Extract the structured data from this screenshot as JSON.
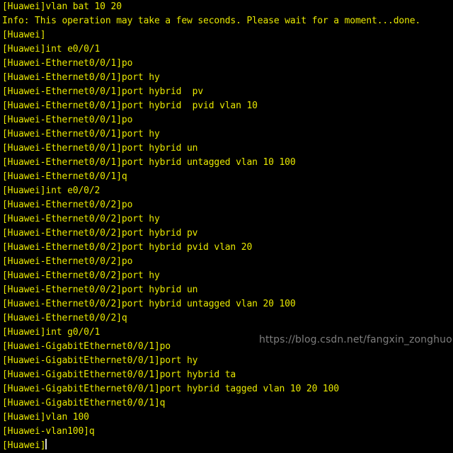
{
  "terminal": {
    "background_color": "#000000",
    "text_color": "#e8e800",
    "cursor_color": "#d9d9d9",
    "lines": [
      "[Huawei]vlan bat 10 20",
      "Info: This operation may take a few seconds. Please wait for a moment...done.",
      "[Huawei]",
      "[Huawei]int e0/0/1",
      "[Huawei-Ethernet0/0/1]po",
      "[Huawei-Ethernet0/0/1]port hy",
      "[Huawei-Ethernet0/0/1]port hybrid  pv",
      "[Huawei-Ethernet0/0/1]port hybrid  pvid vlan 10",
      "[Huawei-Ethernet0/0/1]po",
      "[Huawei-Ethernet0/0/1]port hy",
      "[Huawei-Ethernet0/0/1]port hybrid un",
      "[Huawei-Ethernet0/0/1]port hybrid untagged vlan 10 100",
      "[Huawei-Ethernet0/0/1]q",
      "[Huawei]int e0/0/2",
      "[Huawei-Ethernet0/0/2]po",
      "[Huawei-Ethernet0/0/2]port hy",
      "[Huawei-Ethernet0/0/2]port hybrid pv",
      "[Huawei-Ethernet0/0/2]port hybrid pvid vlan 20",
      "[Huawei-Ethernet0/0/2]po",
      "[Huawei-Ethernet0/0/2]port hy",
      "[Huawei-Ethernet0/0/2]port hybrid un",
      "[Huawei-Ethernet0/0/2]port hybrid untagged vlan 20 100",
      "[Huawei-Ethernet0/0/2]q",
      "[Huawei]int g0/0/1",
      "[Huawei-GigabitEthernet0/0/1]po",
      "[Huawei-GigabitEthernet0/0/1]port hy",
      "[Huawei-GigabitEthernet0/0/1]port hybrid ta",
      "[Huawei-GigabitEthernet0/0/1]port hybrid tagged vlan 10 20 100",
      "[Huawei-GigabitEthernet0/0/1]q",
      "[Huawei]vlan 100",
      "[Huawei-vlan100]q"
    ],
    "prompt_line": "[Huawei]"
  },
  "watermark": {
    "text": "https://blog.csdn.net/fangxin_zonghuo",
    "color": "#7d7d7d"
  }
}
